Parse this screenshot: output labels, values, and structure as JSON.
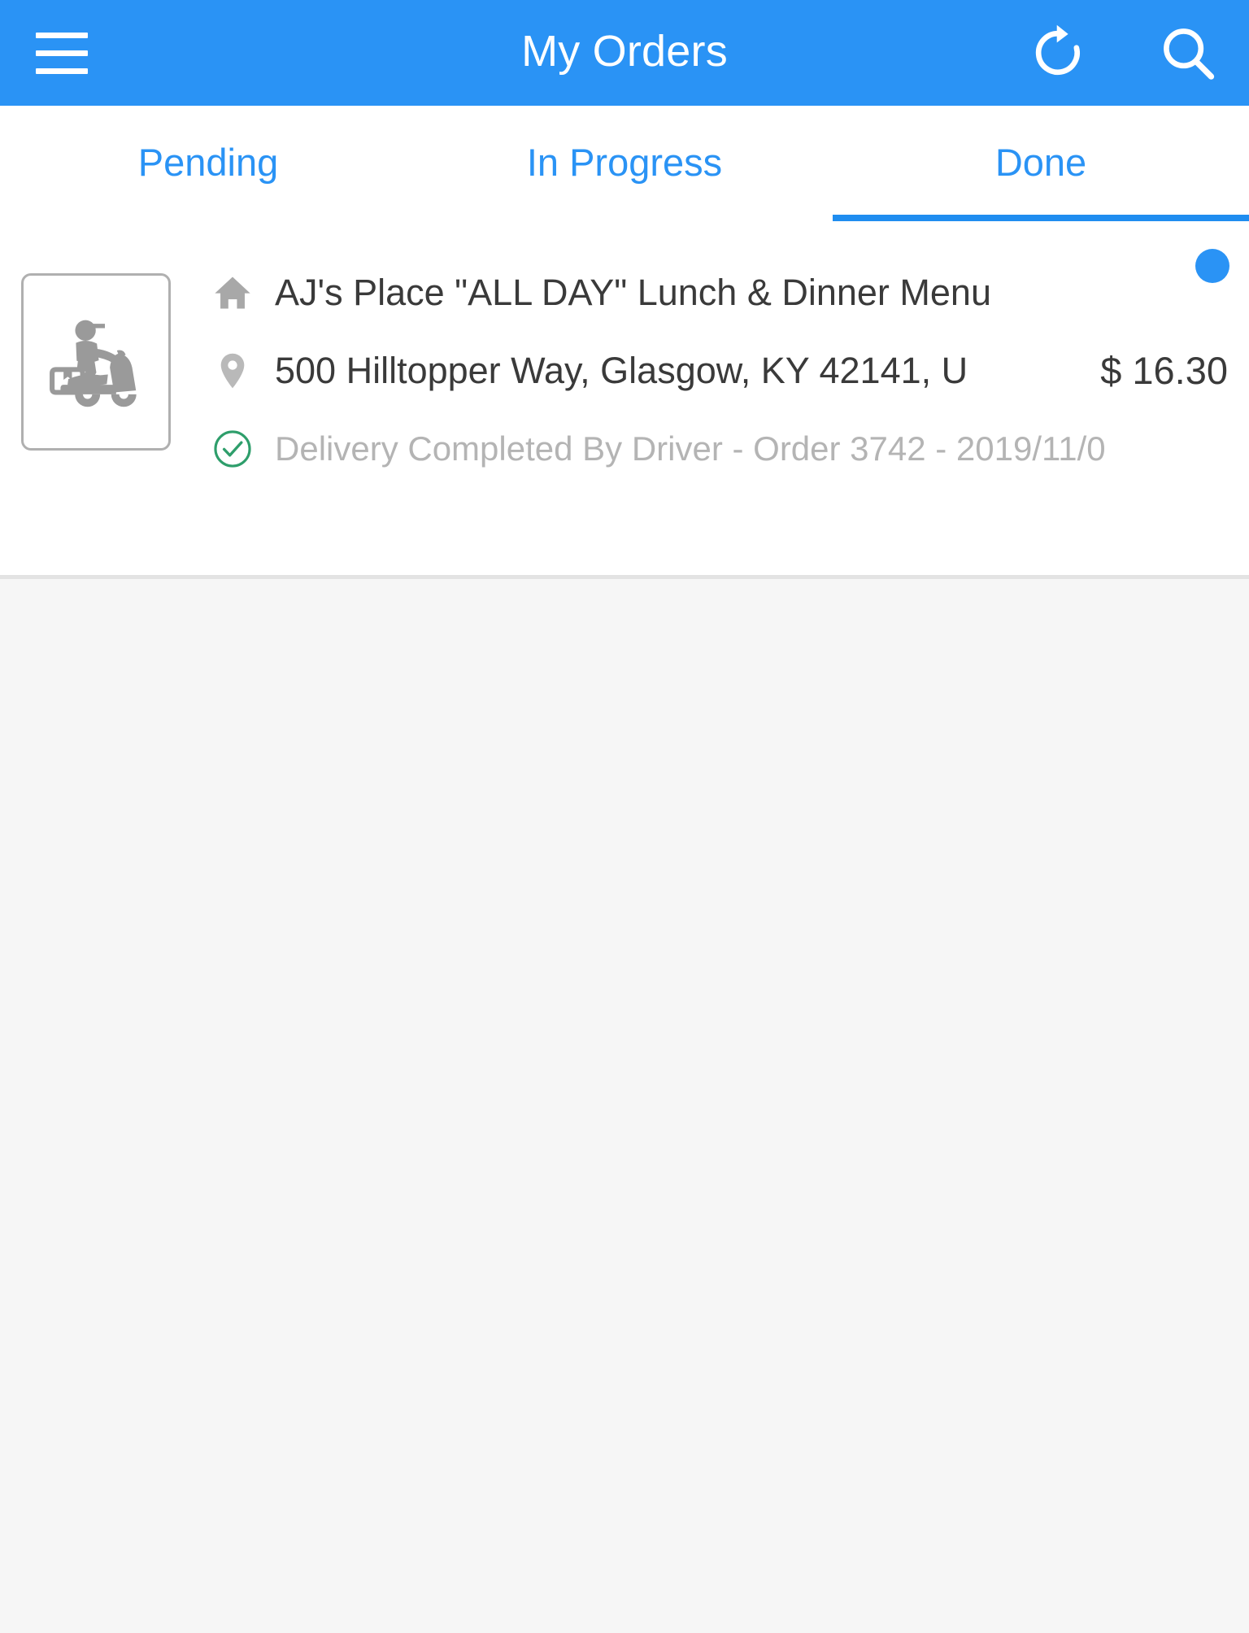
{
  "app": {
    "title": "My Orders",
    "accent_color": "#2a93f5",
    "menu_icon": "hamburger-menu-icon",
    "refresh_icon": "refresh-icon",
    "search_icon": "search-icon"
  },
  "tabs": [
    {
      "label": "Pending",
      "active": false
    },
    {
      "label": "In Progress",
      "active": false
    },
    {
      "label": "Done",
      "active": true
    }
  ],
  "orders": [
    {
      "thumbnail_icon": "delivery-scooter-icon",
      "store_icon": "home-icon",
      "store_name": "AJ's Place \"ALL DAY\" Lunch & Dinner Menu",
      "address_icon": "location-pin-icon",
      "address": "500 Hilltopper Way, Glasgow, KY 42141, U",
      "price": "$ 16.30",
      "status_icon": "check-circle-icon",
      "status_color": "#2e9e6b",
      "status": "Delivery Completed By Driver - Order 3742 - 2019/11/0",
      "unread_badge": true,
      "badge_color": "#2a93f5"
    }
  ]
}
